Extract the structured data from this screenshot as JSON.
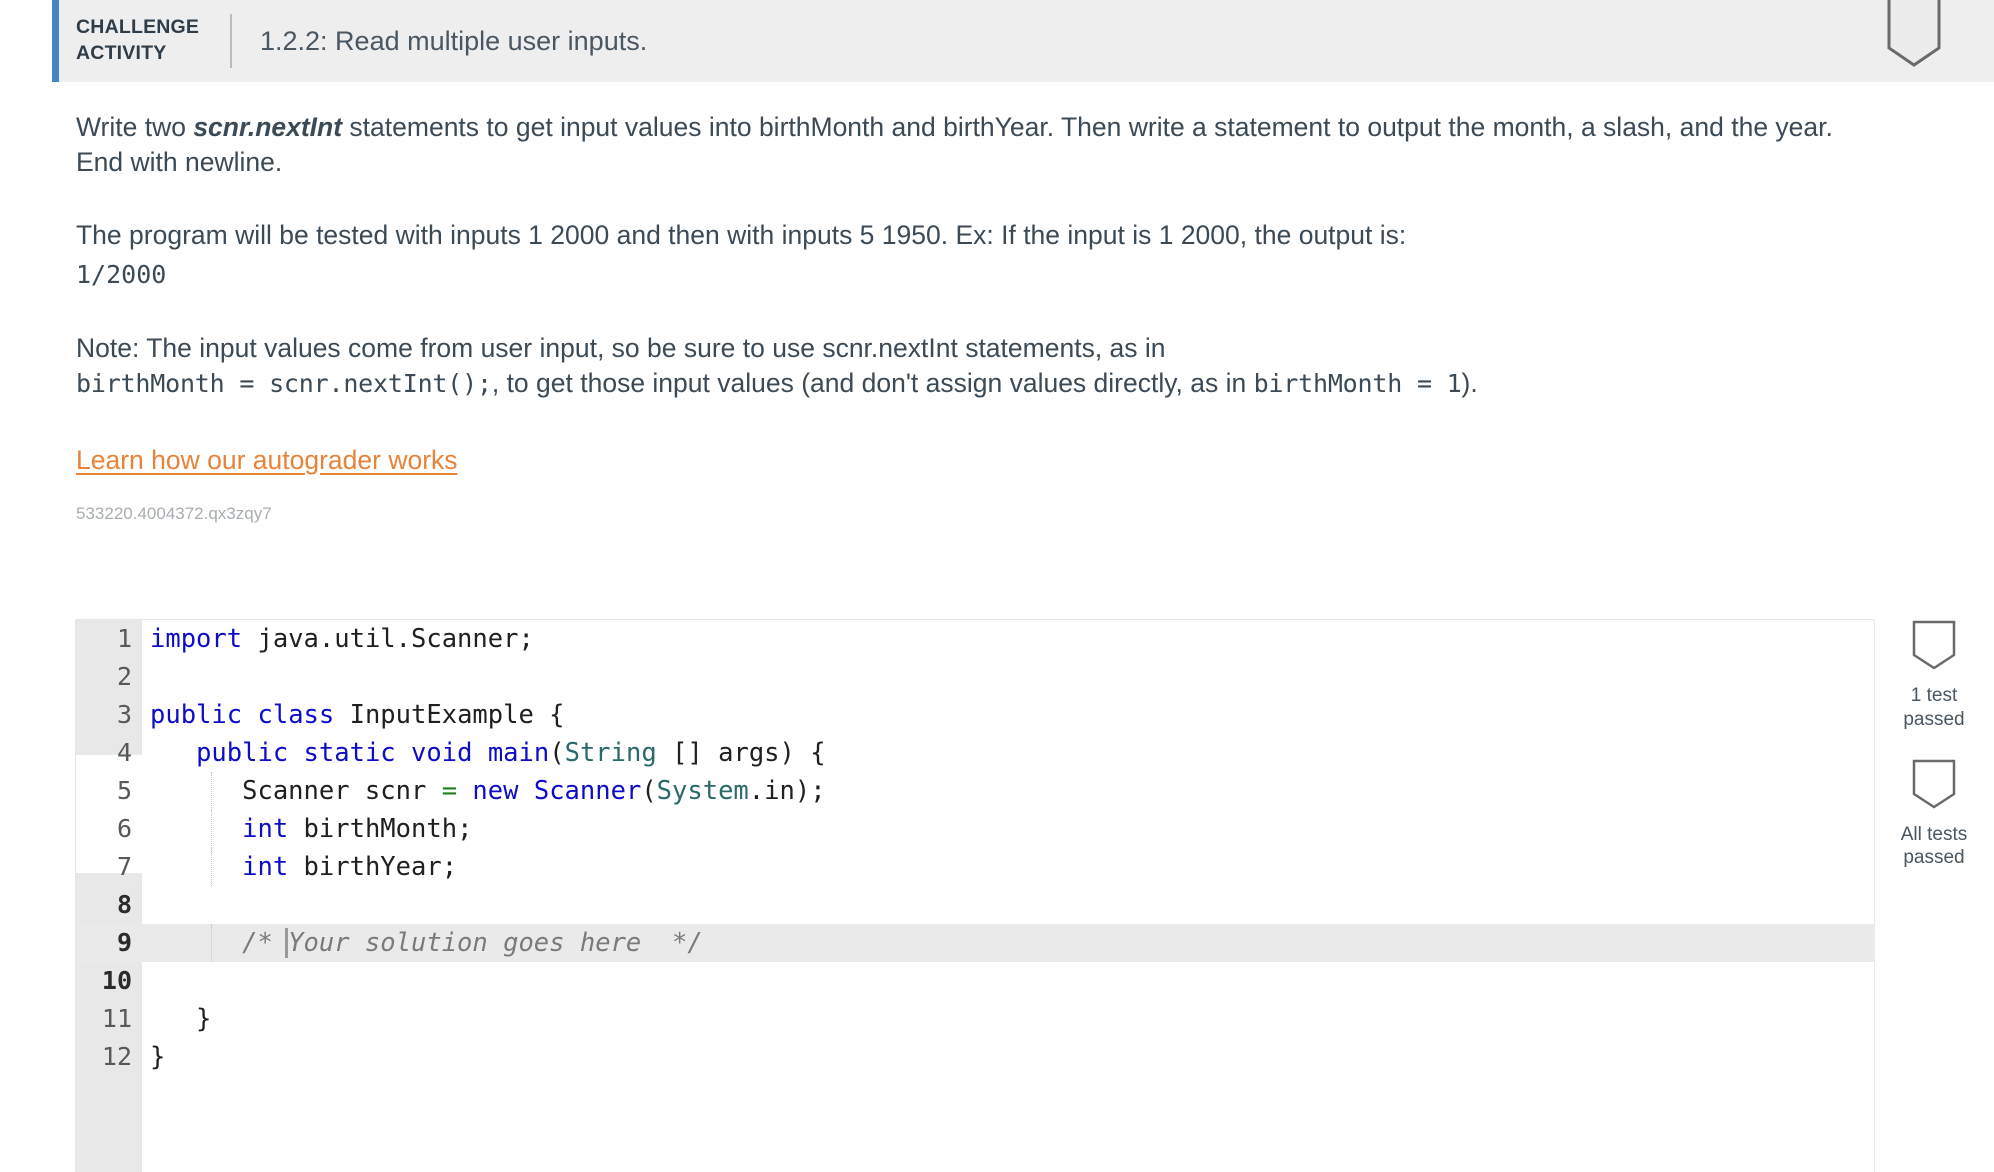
{
  "header": {
    "kicker": "CHALLENGE ACTIVITY",
    "title": "1.2.2: Read multiple user inputs.",
    "accent_color": "#4286c6",
    "background": "#eeeeee",
    "badge_icon": "award-ribbon-icon"
  },
  "prompt": {
    "p1_a": "Write two ",
    "p1_code": "scnr.nextInt",
    "p1_b": " statements to get input values into birthMonth and birthYear. Then write a statement to output the month, a slash, and the year. End with newline.",
    "p2": "The program will be tested with inputs 1 2000 and then with inputs 5 1950. Ex: If the input is 1 2000, the output is:",
    "p2_output": "1/2000",
    "p3_a": "Note: The input values come from user input, so be sure to use scnr.nextInt statements, as in",
    "p3_code1": "birthMonth = scnr.nextInt();",
    "p3_b": ", to get those input values (and don't assign values directly, as in ",
    "p3_code2": "birthMonth = 1",
    "p3_c": ").",
    "link": "Learn how our autograder works",
    "link_color": "#e8833a",
    "activity_id": "533220.4004372.qx3zqy7"
  },
  "editor": {
    "lines": [
      {
        "n": "1",
        "editable": false,
        "active": false,
        "guide": false,
        "tokens": [
          {
            "t": "import",
            "c": "kw"
          },
          {
            "t": " java.util.Scanner;",
            "c": ""
          }
        ]
      },
      {
        "n": "2",
        "editable": false,
        "active": false,
        "guide": false,
        "tokens": []
      },
      {
        "n": "3",
        "editable": false,
        "active": false,
        "guide": false,
        "tokens": [
          {
            "t": "public",
            "c": "kw"
          },
          {
            "t": " ",
            "c": ""
          },
          {
            "t": "class",
            "c": "kw"
          },
          {
            "t": " InputExample {",
            "c": ""
          }
        ]
      },
      {
        "n": "4",
        "editable": false,
        "active": false,
        "guide": false,
        "tokens": [
          {
            "t": "   ",
            "c": ""
          },
          {
            "t": "public",
            "c": "kw"
          },
          {
            "t": " ",
            "c": ""
          },
          {
            "t": "static",
            "c": "kw"
          },
          {
            "t": " ",
            "c": ""
          },
          {
            "t": "void",
            "c": "kw"
          },
          {
            "t": " ",
            "c": ""
          },
          {
            "t": "main",
            "c": "kw"
          },
          {
            "t": "(",
            "c": ""
          },
          {
            "t": "String",
            "c": "typ"
          },
          {
            "t": " [] args) {",
            "c": ""
          }
        ]
      },
      {
        "n": "5",
        "editable": false,
        "active": false,
        "guide": true,
        "tokens": [
          {
            "t": "      Scanner scnr ",
            "c": ""
          },
          {
            "t": "=",
            "c": "op"
          },
          {
            "t": " ",
            "c": ""
          },
          {
            "t": "new",
            "c": "kw"
          },
          {
            "t": " ",
            "c": ""
          },
          {
            "t": "Scanner",
            "c": "kw"
          },
          {
            "t": "(",
            "c": ""
          },
          {
            "t": "System",
            "c": "typ"
          },
          {
            "t": ".in);",
            "c": ""
          }
        ]
      },
      {
        "n": "6",
        "editable": false,
        "active": false,
        "guide": true,
        "tokens": [
          {
            "t": "      ",
            "c": ""
          },
          {
            "t": "int",
            "c": "kw"
          },
          {
            "t": " birthMonth;",
            "c": ""
          }
        ]
      },
      {
        "n": "7",
        "editable": false,
        "active": false,
        "guide": true,
        "tokens": [
          {
            "t": "      ",
            "c": ""
          },
          {
            "t": "int",
            "c": "kw"
          },
          {
            "t": " birthYear;",
            "c": ""
          }
        ]
      },
      {
        "n": "8",
        "editable": true,
        "active": false,
        "guide": false,
        "tokens": []
      },
      {
        "n": "9",
        "editable": true,
        "active": true,
        "guide": true,
        "tokens": [
          {
            "t": "      /* Your solution goes here  */",
            "c": "cmt"
          }
        ]
      },
      {
        "n": "10",
        "editable": true,
        "active": false,
        "guide": false,
        "tokens": []
      },
      {
        "n": "11",
        "editable": false,
        "active": false,
        "guide": false,
        "tokens": [
          {
            "t": "   }",
            "c": ""
          }
        ]
      },
      {
        "n": "12",
        "editable": false,
        "active": false,
        "guide": false,
        "tokens": [
          {
            "t": "}",
            "c": ""
          }
        ]
      }
    ]
  },
  "tests": [
    {
      "icon": "award-ribbon-icon",
      "label": "1 test\npassed"
    },
    {
      "icon": "award-ribbon-icon",
      "label": "All tests\npassed"
    }
  ]
}
